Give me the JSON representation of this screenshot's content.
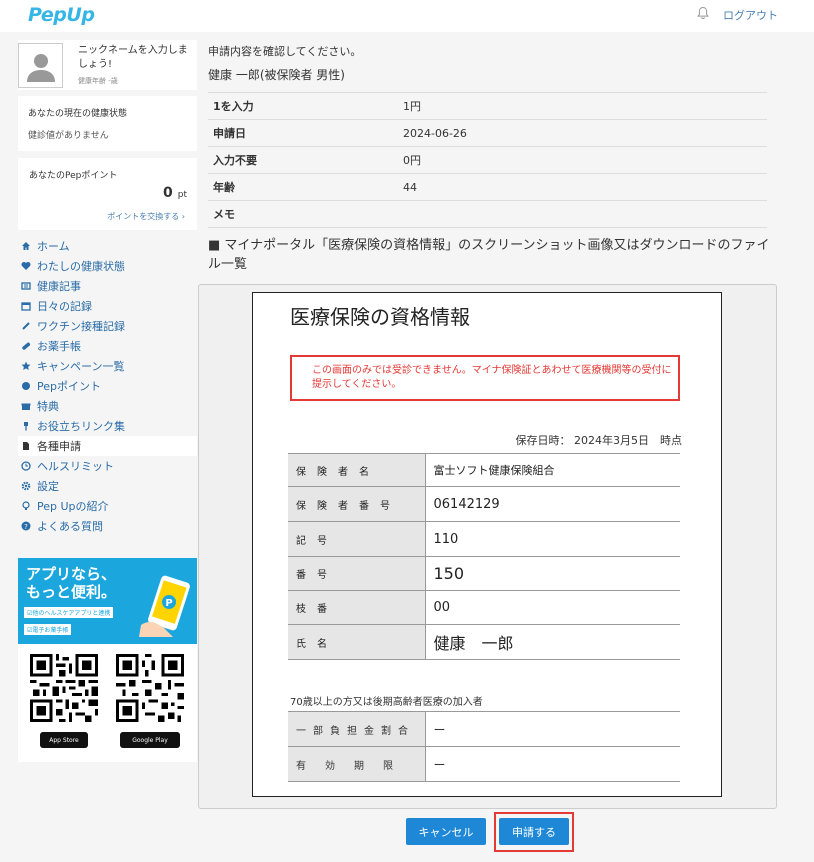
{
  "header": {
    "logo": "PepUp",
    "logout": "ログアウト"
  },
  "profile": {
    "nickname": "ニックネームを入力しましょう!",
    "age": "健康年齢  -歳"
  },
  "health": {
    "title": "あなたの現在の健康状態",
    "status": "健診値がありません"
  },
  "points": {
    "title": "あなたのPepポイント",
    "value": "0",
    "unit": "pt",
    "exchange": "ポイントを交換する ›"
  },
  "nav": [
    {
      "label": "ホーム",
      "icon": "home-icon"
    },
    {
      "label": "わたしの健康状態",
      "icon": "heartbeat-icon"
    },
    {
      "label": "健康記事",
      "icon": "article-icon"
    },
    {
      "label": "日々の記録",
      "icon": "calendar-icon"
    },
    {
      "label": "ワクチン接種記録",
      "icon": "syringe-icon"
    },
    {
      "label": "お薬手帳",
      "icon": "pill-icon"
    },
    {
      "label": "キャンペーン一覧",
      "icon": "star-icon"
    },
    {
      "label": "Pepポイント",
      "icon": "points-icon"
    },
    {
      "label": "特典",
      "icon": "gift-icon"
    },
    {
      "label": "お役立ちリンク集",
      "icon": "pin-icon"
    },
    {
      "label": "各種申請",
      "icon": "document-icon"
    },
    {
      "label": "ヘルスリミット",
      "icon": "clock-icon"
    },
    {
      "label": "設定",
      "icon": "gear-icon"
    },
    {
      "label": "Pep Upの紹介",
      "icon": "bulb-icon"
    },
    {
      "label": "よくある質問",
      "icon": "question-icon"
    }
  ],
  "promo": {
    "line1": "アプリなら、",
    "line2": "もっと便利。",
    "tag1": "☑他のヘルスケアアプリと連携",
    "tag2": "☑電子お薬手帳",
    "appstore": "App Store",
    "googleplay": "Google Play"
  },
  "main": {
    "confirm": "申請内容を確認してください。",
    "person": "健康 一郎(被保険者 男性)",
    "rows": [
      {
        "k": "1を入力",
        "v": "1円"
      },
      {
        "k": "申請日",
        "v": "2024-06-26"
      },
      {
        "k": "入力不要",
        "v": "0円"
      },
      {
        "k": "年齢",
        "v": "44"
      },
      {
        "k": "メモ",
        "v": ""
      }
    ],
    "section": "■ マイナポータル「医療保険の資格情報」のスクリーンショット画像又はダウンロードのファイル一覧"
  },
  "doc": {
    "title": "医療保険の資格情報",
    "warning": "この画面のみでは受診できません。マイナ保険証とあわせて医療機関等の受付に提示してください。",
    "saved": "保存日時： 2024年3月5日　時点",
    "rows": [
      {
        "k": "保険者名",
        "v": "富士ソフト健康保険組合"
      },
      {
        "k": "保険者番号",
        "v": "06142129"
      },
      {
        "k": "記号",
        "v": "110"
      },
      {
        "k": "番号",
        "v": "150"
      },
      {
        "k": "枝番",
        "v": "00"
      },
      {
        "k": "氏名",
        "v": "健康　一郎"
      }
    ],
    "subhead": "70歳以上の方又は後期高齢者医療の加入者",
    "rows2": [
      {
        "k": "一部負担金割合",
        "v": "ー"
      },
      {
        "k": "有効期限",
        "v": "ー"
      }
    ]
  },
  "buttons": {
    "cancel": "キャンセル",
    "apply": "申請する"
  }
}
